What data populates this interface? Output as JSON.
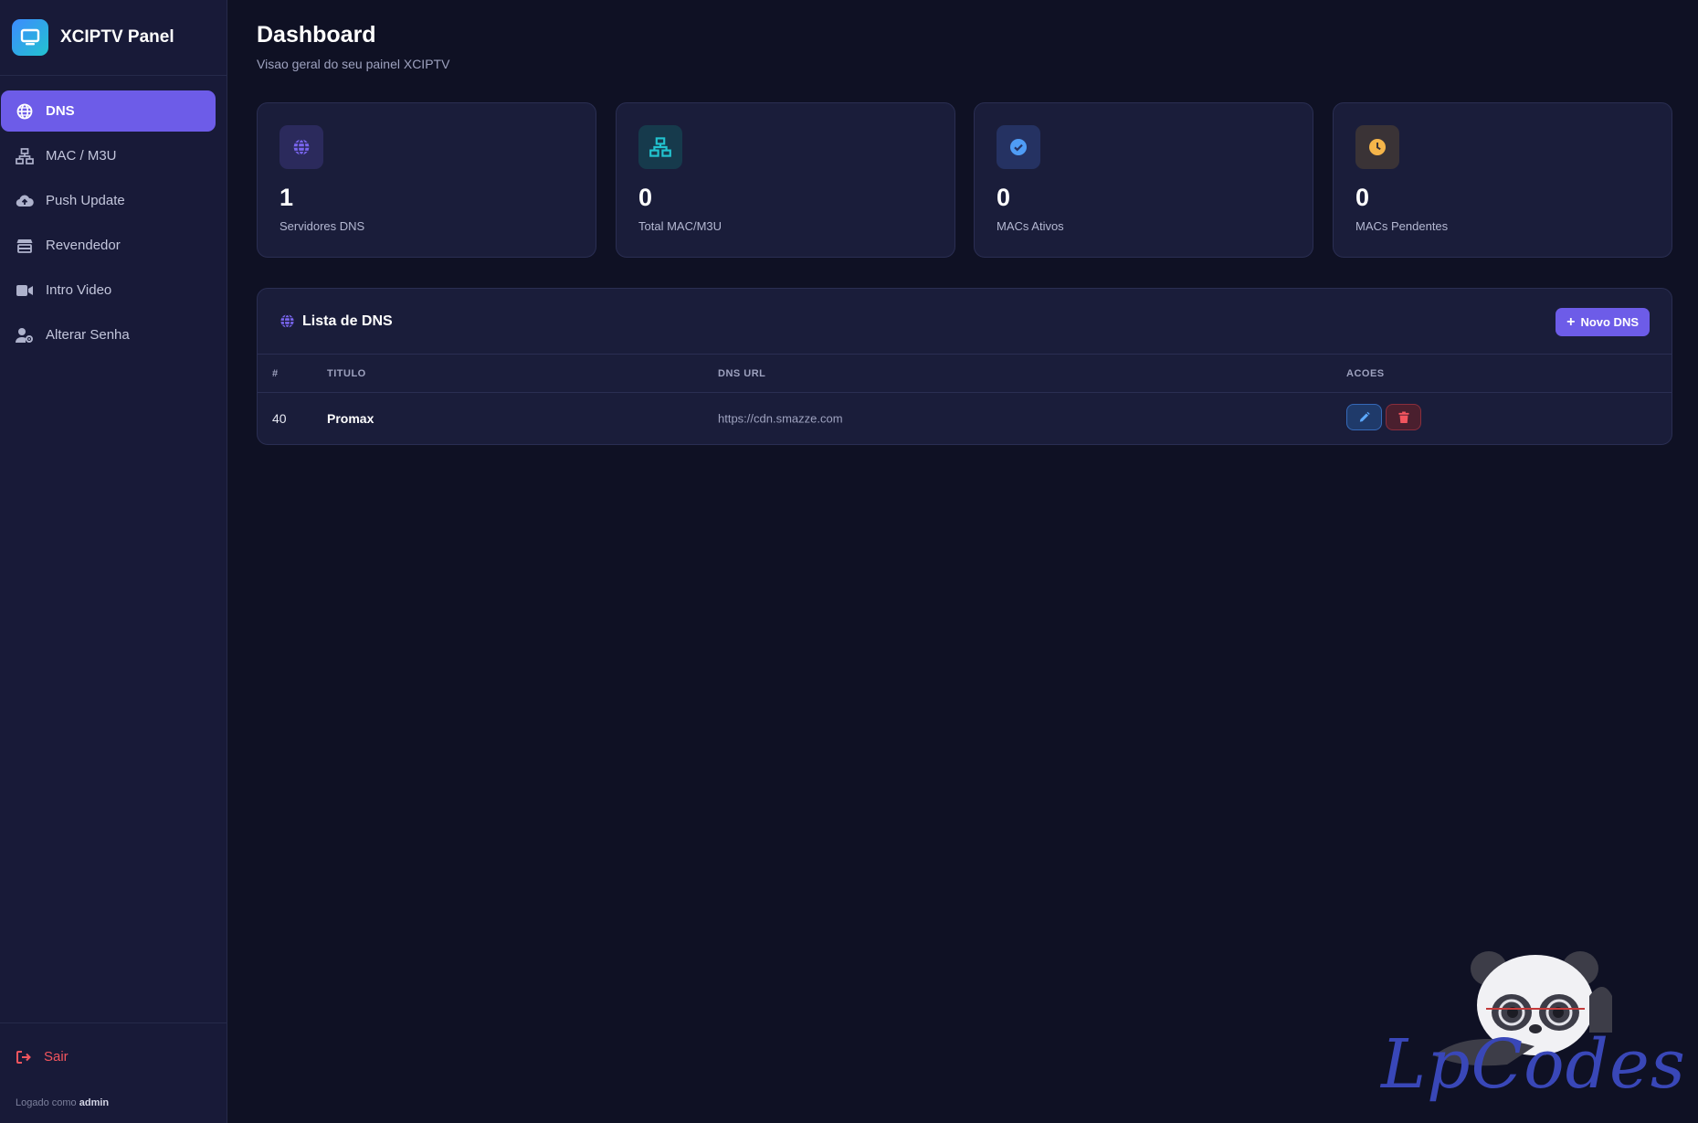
{
  "app": {
    "title": "XCIPTV Panel"
  },
  "sidebar": {
    "items": [
      {
        "label": "DNS",
        "icon": "globe-icon",
        "active": true
      },
      {
        "label": "MAC / M3U",
        "icon": "network-icon",
        "active": false
      },
      {
        "label": "Push Update",
        "icon": "cloud-upload-icon",
        "active": false
      },
      {
        "label": "Revendedor",
        "icon": "store-icon",
        "active": false
      },
      {
        "label": "Intro Video",
        "icon": "video-icon",
        "active": false
      },
      {
        "label": "Alterar Senha",
        "icon": "user-gear-icon",
        "active": false
      }
    ],
    "logout_label": "Sair",
    "logged_prefix": "Logado como",
    "logged_user": "admin"
  },
  "header": {
    "title": "Dashboard",
    "subtitle": "Visao geral do seu painel XCIPTV"
  },
  "stats": [
    {
      "value": "1",
      "label": "Servidores DNS",
      "icon": "globe-icon",
      "color": "#6d5ce8"
    },
    {
      "value": "0",
      "label": "Total MAC/M3U",
      "icon": "network-icon",
      "color": "#22c3cf"
    },
    {
      "value": "0",
      "label": "MACs Ativos",
      "icon": "check-circle-icon",
      "color": "#4f9cf5"
    },
    {
      "value": "0",
      "label": "MACs Pendentes",
      "icon": "clock-icon",
      "color": "#f5b54a"
    }
  ],
  "dns_panel": {
    "title": "Lista de DNS",
    "new_button": "Novo DNS",
    "columns": [
      "#",
      "TITULO",
      "DNS URL",
      "ACOES"
    ],
    "rows": [
      {
        "id": "40",
        "title": "Promax",
        "url": "https://cdn.smazze.com"
      }
    ]
  },
  "watermark": {
    "text": "LpCodes"
  },
  "colors": {
    "accent": "#6d5ce8",
    "background": "#0f1124",
    "sidebar": "#181a38",
    "danger": "#f2555e"
  }
}
